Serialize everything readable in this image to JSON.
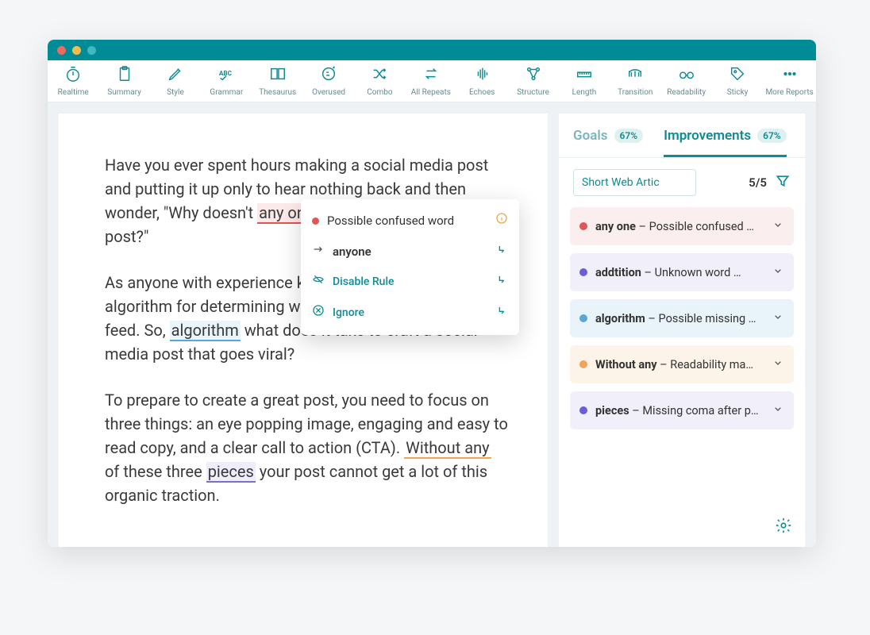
{
  "toolbar": [
    {
      "label": "Realtime",
      "icon": "timer-icon"
    },
    {
      "label": "Summary",
      "icon": "clipboard-icon"
    },
    {
      "label": "Style",
      "icon": "pen-icon"
    },
    {
      "label": "Grammar",
      "icon": "abc-icon"
    },
    {
      "label": "Thesaurus",
      "icon": "book-icon"
    },
    {
      "label": "Overused",
      "icon": "snooze-icon"
    },
    {
      "label": "Combo",
      "icon": "shuffle-icon"
    },
    {
      "label": "All Repeats",
      "icon": "repeat-icon"
    },
    {
      "label": "Echoes",
      "icon": "soundwave-icon"
    },
    {
      "label": "Structure",
      "icon": "nodes-icon"
    },
    {
      "label": "Length",
      "icon": "ruler-icon"
    },
    {
      "label": "Transition",
      "icon": "bridge-icon"
    },
    {
      "label": "Readability",
      "icon": "glasses-icon"
    },
    {
      "label": "Sticky",
      "icon": "tag-icon"
    },
    {
      "label": "More Reports",
      "icon": "dots-icon"
    }
  ],
  "document": {
    "p1_a": "Have you ever spent hours making a social media post and putting it up only to hear nothing back and then wonder, \"Why doesn't ",
    "p1_hl": "any one",
    "p1_b": " care about this amazing post?\"",
    "p2_a": "As anyone with experience knows, social media has an algorithm for determining what content on your news feed. So, ",
    "p2_hl": "algorithm",
    "p2_b": " what does it take to craft a social media post that goes viral?",
    "p3_a": "To prepare to create a great post, you need to focus on three things: an eye popping image, engaging and easy to read copy, and a clear call to action (CTA). ",
    "p3_hl1": "Without any",
    "p3_mid": " of these three ",
    "p3_hl2": "pieces",
    "p3_b": " your post cannot get a lot of this organic traction."
  },
  "popup": {
    "title": "Possible confused word",
    "suggestion": "anyone",
    "disable": "Disable Rule",
    "ignore": "Ignore"
  },
  "sidebar": {
    "tabs": {
      "goals": {
        "label": "Goals",
        "badge": "67%"
      },
      "improvements": {
        "label": "Improvements",
        "badge": "67%"
      }
    },
    "filter_value": "Short Web Artic",
    "count": "5/5",
    "issues": [
      {
        "color": "red",
        "term": "any one",
        "desc": "Possible confused …"
      },
      {
        "color": "purple",
        "term": "addtition",
        "desc": "Unknown word …"
      },
      {
        "color": "blue",
        "term": "algorithm",
        "desc": "Possible missing …"
      },
      {
        "color": "orange",
        "term": "Without any",
        "desc": "Readability ma…"
      },
      {
        "color": "purple",
        "term": "pieces",
        "desc": "Missing coma after p…"
      }
    ]
  }
}
